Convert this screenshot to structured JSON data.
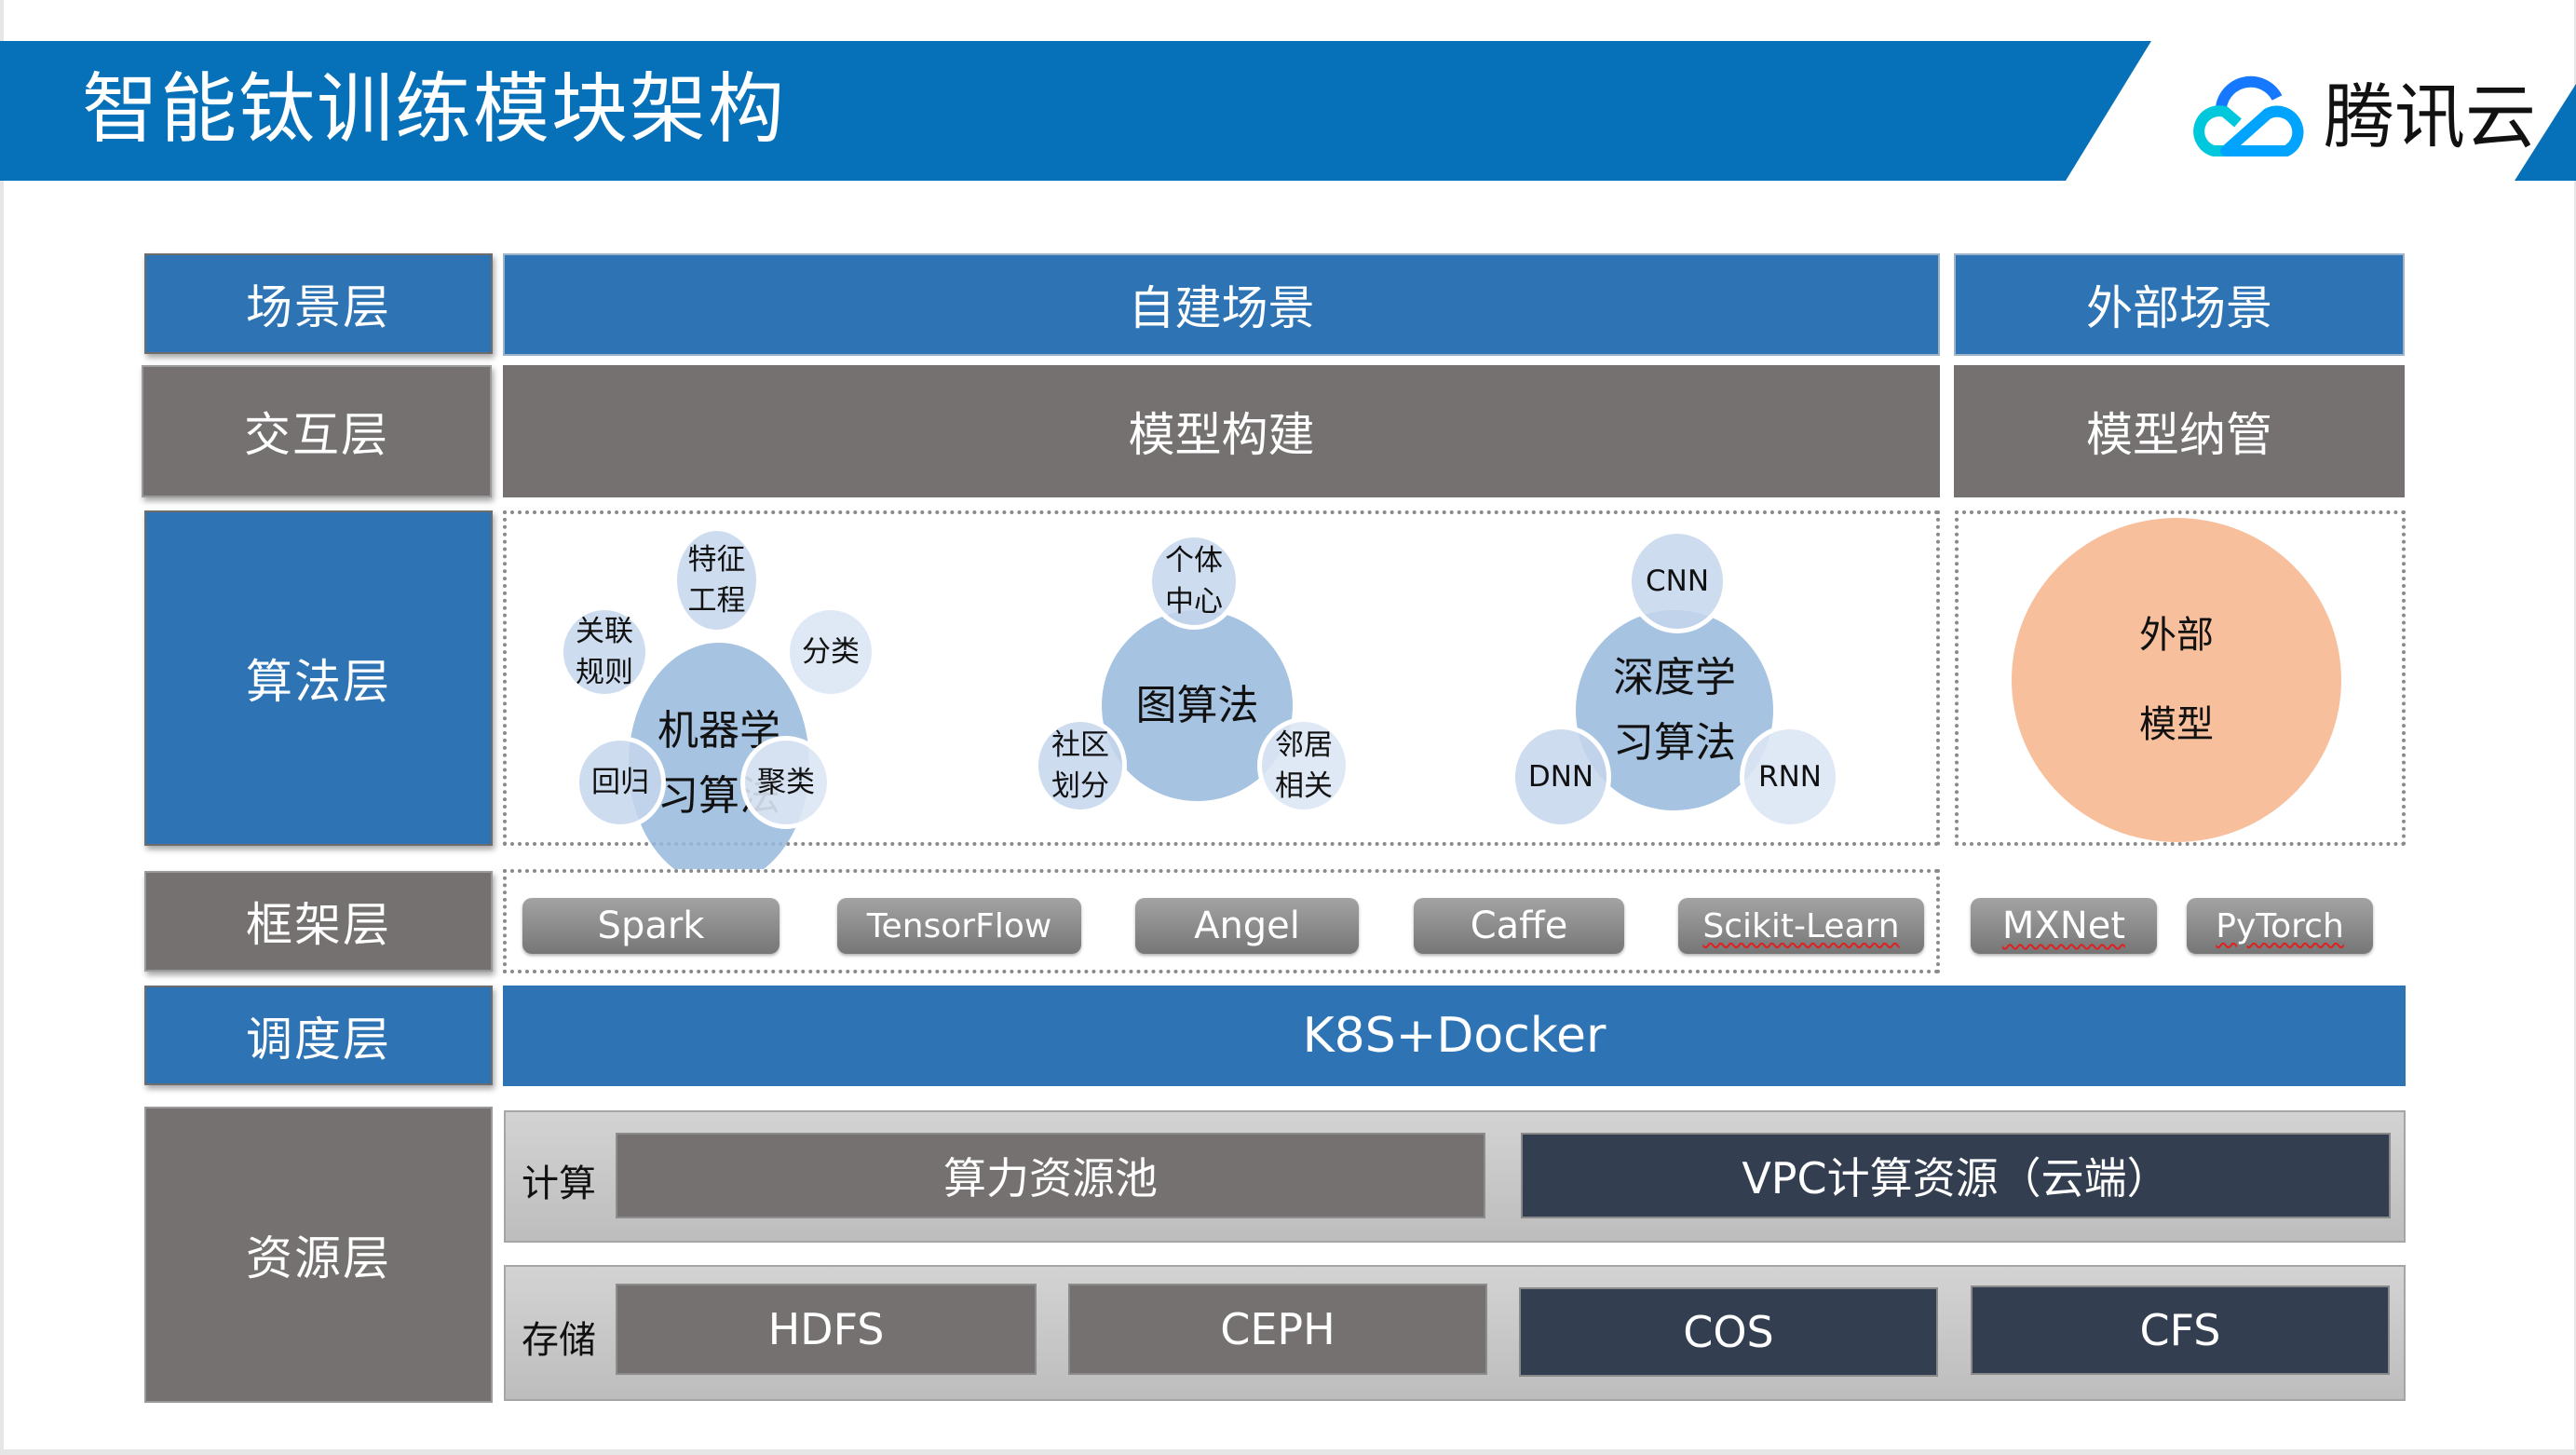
{
  "header": {
    "title": "智能钛训练模块架构",
    "logo_text": "腾讯云",
    "logo_icon": "tencent-cloud-logo-icon"
  },
  "layers": {
    "scene": {
      "label": "场景层",
      "main": "自建场景",
      "side": "外部场景"
    },
    "interaction": {
      "label": "交互层",
      "main": "模型构建",
      "side": "模型纳管"
    },
    "algorithm": {
      "label": "算法层",
      "groups": [
        {
          "center": [
            "机器学",
            "习算法"
          ],
          "satellites": [
            [
              "特征",
              "工程"
            ],
            [
              "关联",
              "规则"
            ],
            [
              "分类"
            ],
            [
              "回归"
            ],
            [
              "聚类"
            ]
          ]
        },
        {
          "center": [
            "图算法"
          ],
          "satellites": [
            [
              "个体",
              "中心"
            ],
            [
              "社区",
              "划分"
            ],
            [
              "邻居",
              "相关"
            ]
          ]
        },
        {
          "center": [
            "深度学",
            "习算法"
          ],
          "satellites": [
            [
              "CNN"
            ],
            [
              "DNN"
            ],
            [
              "RNN"
            ]
          ]
        }
      ],
      "external": [
        "外部",
        "模型"
      ]
    },
    "framework": {
      "label": "框架层",
      "items": [
        "Spark",
        "TensorFlow",
        "Angel",
        "Caffe",
        "Scikit-Learn",
        "MXNet",
        "PyTorch"
      ]
    },
    "scheduling": {
      "label": "调度层",
      "main": "K8S+Docker"
    },
    "resource": {
      "label": "资源层",
      "compute": {
        "label": "计算",
        "items": [
          "算力资源池",
          "VPC计算资源（云端）"
        ]
      },
      "storage": {
        "label": "存储",
        "items": [
          "HDFS",
          "CEPH",
          "COS",
          "CFS"
        ]
      }
    }
  },
  "colors": {
    "header_blue": "#0670b8",
    "layer_blue": "#2e74b5",
    "layer_grey": "#767171",
    "navy": "#333f50",
    "bubble_blue": "#96b8dc",
    "orange": "#f7bf9c"
  }
}
